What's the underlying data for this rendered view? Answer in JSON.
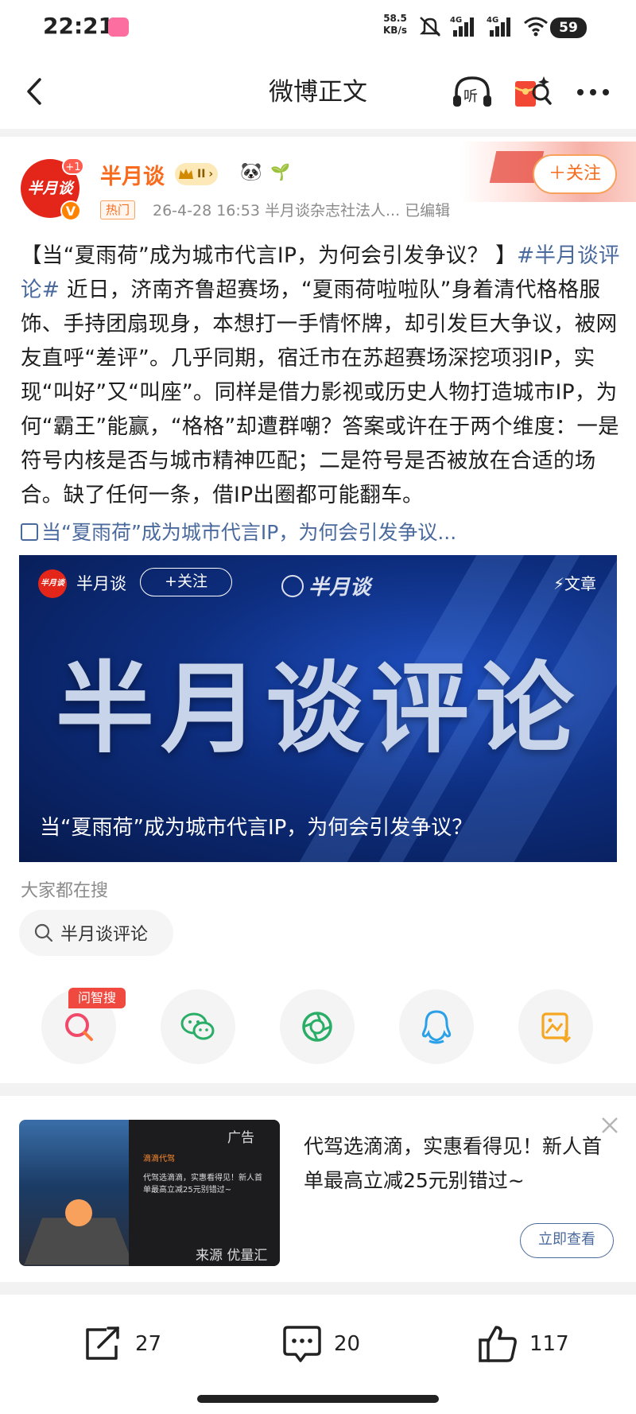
{
  "status_bar": {
    "time": "22:21",
    "net_speed_value": "58.5",
    "net_speed_unit": "KB/s",
    "signal1_label": "4G",
    "signal2_label": "4G",
    "battery": "59"
  },
  "nav": {
    "title": "微博正文"
  },
  "post": {
    "author": "半月谈",
    "level_badge": "II",
    "hot_tag": "热门",
    "meta": "26-4-28 16:53  半月谈杂志社法人...  已编辑",
    "follow_label": "＋关注",
    "avatar_text": "半月谈",
    "avatar_plus": "+1",
    "text_intro": "【当“夏雨荷”成为城市代言IP，为何会引发争议？ 】",
    "hashtag": "#半月谈评论#",
    "text_body": " 近日，济南齐鲁超赛场，“夏雨荷啦啦队”身着清代格格服饰、手持团扇现身，本想打一手情怀牌，却引发巨大争议，被网友直呼“差评”。几乎同期，宿迁市在苏超赛场深挖项羽IP，实现“叫好”又“叫座”。同样是借力影视或历史人物打造城市IP，为何“霸王”能赢，“格格”却遭群嘲？答案或许在于两个维度：一是符号内核是否与城市精神匹配；二是符号是否被放在合适的场合。缺了任何一条，借IP出圈都可能翻车。",
    "link_text": "当“夏雨荷”成为城市代言IP，为何会引发争议..."
  },
  "card": {
    "author": "半月谈",
    "follow_label": "+关注",
    "brand": "半月谈",
    "type_label": "文章",
    "big_title": "半月谈评论",
    "caption": "当“夏雨荷”成为城市代言IP，为何会引发争议？",
    "logo_text": "半月谈"
  },
  "search": {
    "title": "大家都在搜",
    "query": "半月谈评论"
  },
  "share": {
    "badge": "问智搜",
    "items": [
      "wenzhisou-icon",
      "wechat-icon",
      "moments-icon",
      "qq-icon",
      "save-image-icon"
    ]
  },
  "ad": {
    "label": "广告",
    "source": "来源 优量汇",
    "text": "代驾选滴滴，实惠看得见！新人首单最高立减25元别错过~",
    "button": "立即查看",
    "inner_brand": "滴滴代驾",
    "inner_text": "代驾选滴滴，实惠看得见！新人首单最高立减25元别错过~"
  },
  "toolbar": {
    "repost_count": "27",
    "comment_count": "20",
    "like_count": "117"
  },
  "colors": {
    "accent_orange": "#f86b1d",
    "link_blue": "#4a6a9e",
    "card_blue": "#0d2d7e",
    "red": "#e32619"
  }
}
